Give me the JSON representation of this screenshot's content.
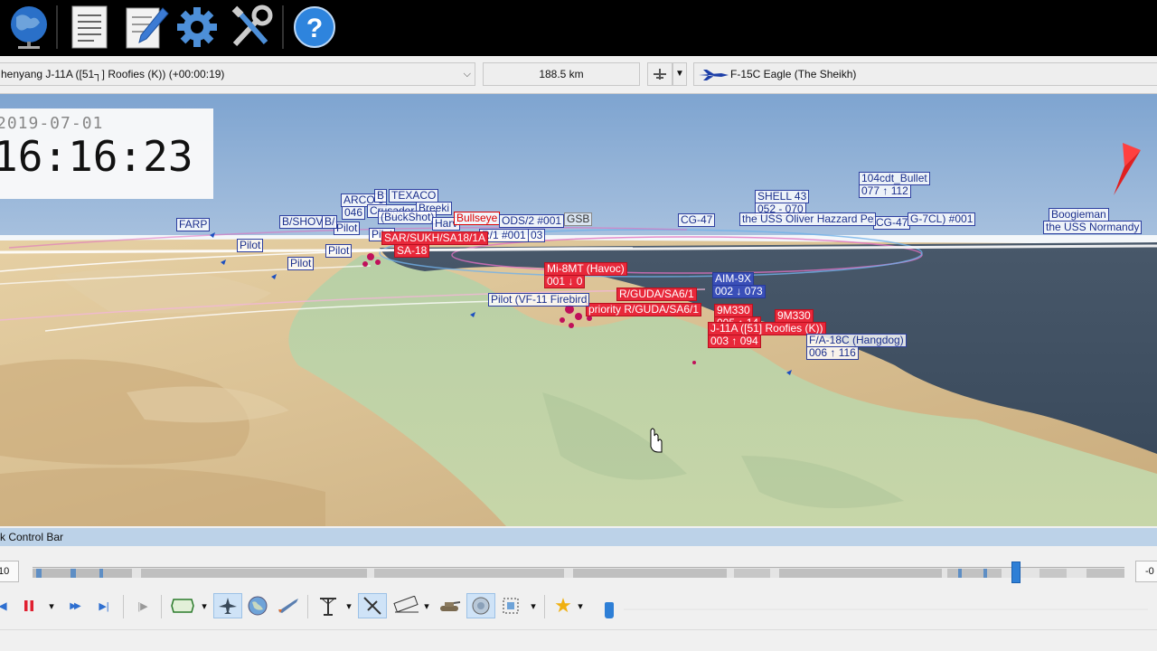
{
  "toolbar": {
    "buttons": [
      {
        "icon": "globe-network-icon"
      },
      {
        "icon": "document-icon"
      },
      {
        "icon": "edit-notes-icon"
      },
      {
        "icon": "gear-icon"
      },
      {
        "icon": "tools-icon"
      },
      {
        "icon": "help-icon",
        "glyph": "?"
      }
    ]
  },
  "selection": {
    "target": "henyang J-11A ([51┐] Roofies (K)) (+00:00:19)",
    "range": "188.5 km",
    "viewer": "F-15C Eagle (The Sheikh)"
  },
  "clock": {
    "date": "2019-07-01",
    "time": "16:16:23"
  },
  "labels": {
    "farp": "FARP",
    "pilot1": "Pilot",
    "pilot2": "Pilot",
    "pilot3": "Pilot",
    "pilot4": "Pilot",
    "pilot5": "Pilot",
    "bshov1": "B/SHOV",
    "bshov2": "B/",
    "arco": "ARCO 3",
    "arco2": "046",
    "texaco": "TEXACO",
    "texaco_prefix": "B",
    "crusader": "Crusader",
    "breeki": "Breeki",
    "buckshot": "(BuckShot)",
    "harv": "Harv",
    "bullseye": "Bullseye",
    "ods": "ODS/2 #001",
    "gsb": "GSB",
    "r1": "R/1 #001",
    "r1_suffix": "03",
    "sar_sukh": "SAR/SUKH/SA18/1A",
    "sa18": "SA-18",
    "cg47a": "CG-47",
    "cg47b": "CG-47",
    "shell": "SHELL 43",
    "shell2": "052 - 070",
    "bullet": "104cdt_Bullet",
    "bullet2": "077 ↑ 112",
    "perry": "the USS Oliver Hazzard Pe",
    "perry2": "G-7CL) #001",
    "boogieman": "Boogieman",
    "normandy": "the USS Normandy",
    "mi8": "Mi-8MT (Havoc)",
    "mi8b": "001 ↓ 0",
    "guda1": "R/GUDA/SA6/1",
    "priority": "priority R/GUDA/SA6/1",
    "pilot_vf11": "Pilot (VF-11 Firebird",
    "aim9x": "AIM-9X",
    "aim9x2": "002 ↓ 073",
    "m9330a": "9M330",
    "m9330a2": "005 ↑ 14",
    "m9330b": "9M330",
    "j11a": "J-11A ([51] Roofies (K))",
    "j11a2": "003 ↑ 094",
    "hornet": "F/A-18C (Hangdog)",
    "hornet2": "006 ↑ 116"
  },
  "control_bar": {
    "title": "k Control Bar",
    "start": "10",
    "end": "-0",
    "buttons": [
      {
        "icon": "step-back-icon",
        "glyph": "◀"
      },
      {
        "icon": "pause-icon"
      },
      {
        "icon": "dropdown-icon",
        "glyph": "▾"
      },
      {
        "icon": "fast-forward-icon",
        "glyph": "▶▶"
      },
      {
        "icon": "skip-end-icon",
        "glyph": "▶|"
      },
      {
        "icon": "step-forward-icon",
        "glyph": "|▶"
      },
      {
        "icon": "camera-frame-icon"
      },
      {
        "icon": "aircraft-icon"
      },
      {
        "icon": "globe-icon"
      },
      {
        "icon": "missile-icon"
      },
      {
        "icon": "tower-icon"
      },
      {
        "icon": "radar-icon"
      },
      {
        "icon": "ruler-icon"
      },
      {
        "icon": "tank-icon"
      },
      {
        "icon": "satellite-dish-icon"
      },
      {
        "icon": "screenshot-icon"
      },
      {
        "icon": "star-icon",
        "glyph": "★"
      }
    ]
  },
  "colors": {
    "toolbar_bg": "#000000",
    "sea": "#3a4f66",
    "blue_label": "#2d3fa0",
    "red_label": "#e8283a",
    "header_bar": "#bcd2e8",
    "thumb": "#2e7fd6"
  }
}
